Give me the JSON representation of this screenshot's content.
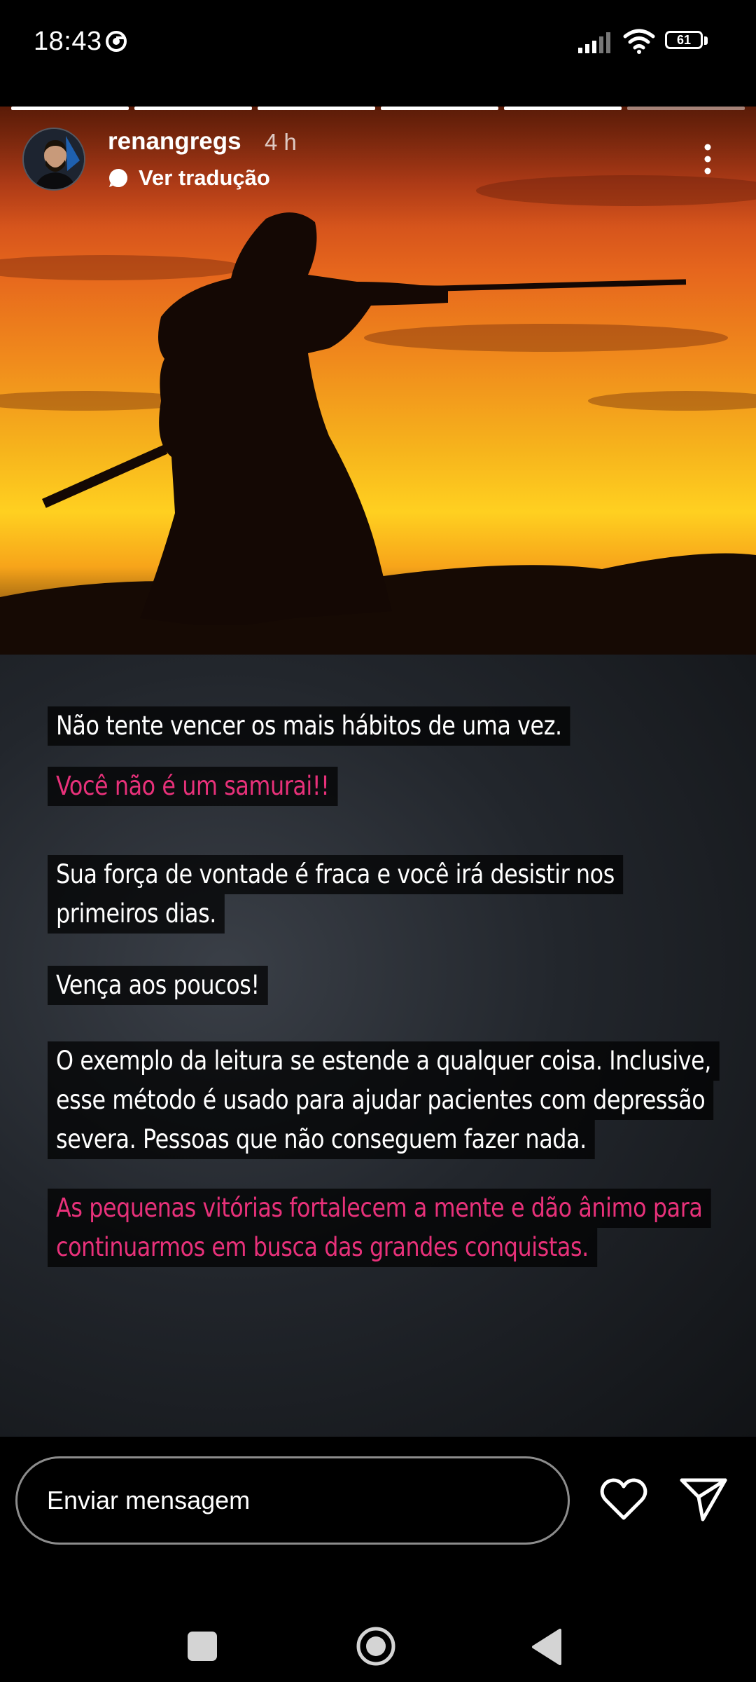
{
  "status_bar": {
    "time": "18:43",
    "battery_level": "61"
  },
  "story": {
    "username": "renangregs",
    "time_ago": "4 h",
    "translate_label": "Ver tradução",
    "progress_segments_total": 6,
    "progress_segments_viewed": 5,
    "paragraphs": [
      {
        "style": "white",
        "lines": [
          "Não tente vencer os mais hábitos de uma vez."
        ]
      },
      {
        "style": "pink",
        "lines": [
          "Você não é um samurai!!"
        ]
      },
      {
        "style": "white",
        "lines": [
          "Sua força de vontade é fraca e você irá desistir nos",
          "primeiros dias."
        ]
      },
      {
        "style": "white",
        "lines": [
          "Vença aos poucos!"
        ]
      },
      {
        "style": "white",
        "lines": [
          "O exemplo da leitura se estende a qualquer coisa. Inclusive,",
          "esse método é usado para ajudar pacientes com depressão",
          "severa. Pessoas que não conseguem fazer nada."
        ]
      },
      {
        "style": "pink",
        "lines": [
          "As pequenas vitórias fortalecem a mente e dão ânimo para",
          "continuarmos em busca das grandes conquistas."
        ]
      }
    ]
  },
  "reply_bar": {
    "placeholder": "Enviar mensagem"
  },
  "colors": {
    "pink_text": "#e8317a",
    "text_bg": "rgba(0,0,0,0.72)",
    "background": "#000000"
  },
  "icons": [
    "chrome-icon",
    "signal-icon",
    "wifi-icon",
    "battery-icon",
    "more-options-icon",
    "translate-icon",
    "heart-icon",
    "send-icon",
    "recents-icon",
    "home-icon",
    "back-icon"
  ]
}
